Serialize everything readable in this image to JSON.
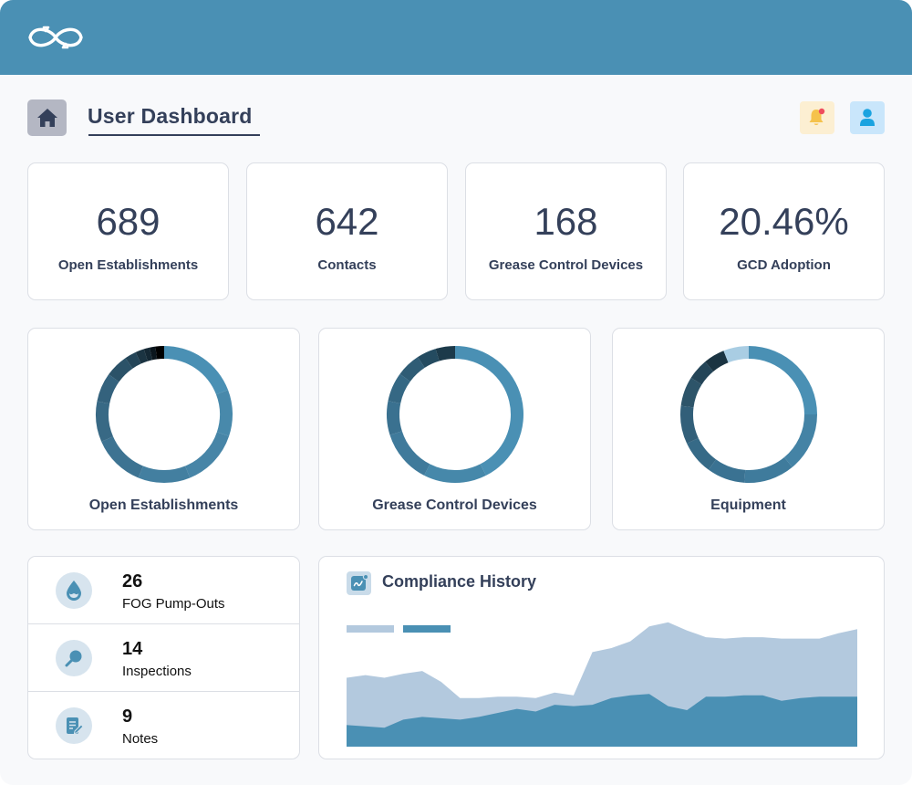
{
  "header": {
    "logo_icon": "infinity-recycle-icon",
    "brand_color": "#4a90b4"
  },
  "page": {
    "title": "User Dashboard",
    "home_icon": "home-icon",
    "notification_icon": "bell-icon",
    "notification_badge": true,
    "profile_icon": "user-icon"
  },
  "stats": [
    {
      "value": "689",
      "label": "Open Establishments"
    },
    {
      "value": "642",
      "label": "Contacts"
    },
    {
      "value": "168",
      "label": "Grease Control Devices"
    },
    {
      "value": "20.46%",
      "label": "GCD Adoption"
    }
  ],
  "donuts": [
    {
      "label": "Open Establishments",
      "segments": [
        {
          "value": 14,
          "color": "#4a90b4"
        },
        {
          "value": 8,
          "color": "#4889ab"
        },
        {
          "value": 10,
          "color": "#4785a7"
        },
        {
          "value": 9,
          "color": "#437fa0"
        },
        {
          "value": 9,
          "color": "#3d7392"
        },
        {
          "value": 7,
          "color": "#386985"
        },
        {
          "value": 5,
          "color": "#34627d"
        },
        {
          "value": 4,
          "color": "#2b5268"
        },
        {
          "value": 2,
          "color": "#244558"
        },
        {
          "value": 1.5,
          "color": "#1b3442"
        },
        {
          "value": 1,
          "color": "#142834"
        },
        {
          "value": 1,
          "color": "#0b161d"
        },
        {
          "value": 1.5,
          "color": "#000000"
        }
      ]
    },
    {
      "label": "Grease Control Devices",
      "segments": [
        {
          "value": 37,
          "color": "#4a90b4"
        },
        {
          "value": 13,
          "color": "#4688aa"
        },
        {
          "value": 11,
          "color": "#3f7a9b"
        },
        {
          "value": 7,
          "color": "#3a7190"
        },
        {
          "value": 6,
          "color": "#356884"
        },
        {
          "value": 5,
          "color": "#2f5c75"
        },
        {
          "value": 4,
          "color": "#244b60"
        },
        {
          "value": 4,
          "color": "#1c3a4a"
        }
      ]
    },
    {
      "label": "Equipment",
      "segments": [
        {
          "value": 25,
          "color": "#4a90b4"
        },
        {
          "value": 14,
          "color": "#4483a5"
        },
        {
          "value": 12,
          "color": "#3f7b9c"
        },
        {
          "value": 9,
          "color": "#3a7292"
        },
        {
          "value": 8,
          "color": "#366a87"
        },
        {
          "value": 9,
          "color": "#325f79"
        },
        {
          "value": 7,
          "color": "#2d5469"
        },
        {
          "value": 5,
          "color": "#244558"
        },
        {
          "value": 5,
          "color": "#1b3442"
        },
        {
          "value": 6,
          "color": "#a9cde3"
        }
      ]
    }
  ],
  "activity": [
    {
      "value": "26",
      "label": "FOG Pump-Outs",
      "icon": "water-drop-icon"
    },
    {
      "value": "14",
      "label": "Inspections",
      "icon": "magnifier-icon"
    },
    {
      "value": "9",
      "label": "Notes",
      "icon": "note-edit-icon"
    }
  ],
  "compliance": {
    "title": "Compliance History",
    "icon": "trend-chart-icon"
  },
  "chart_data": {
    "type": "area",
    "title": "Compliance History",
    "xlabel": "",
    "ylabel": "",
    "ylim": [
      0,
      100
    ],
    "legend_position": "top-left",
    "grid": false,
    "x": [
      0,
      1,
      2,
      3,
      4,
      5,
      6,
      7,
      8,
      9,
      10,
      11,
      12,
      13,
      14,
      15,
      16,
      17,
      18,
      19,
      20,
      21,
      22,
      23,
      24,
      25,
      26,
      27
    ],
    "series": [
      {
        "name": "",
        "color": "#b3c9de",
        "values": [
          51,
          53,
          51,
          54,
          56,
          48,
          36,
          36,
          37,
          37,
          36,
          40,
          38,
          70,
          73,
          78,
          89,
          92,
          86,
          81,
          80,
          81,
          81,
          80,
          80,
          80,
          84,
          87
        ]
      },
      {
        "name": "",
        "color": "#4a90b4",
        "values": [
          16,
          15,
          14,
          20,
          22,
          21,
          20,
          22,
          25,
          28,
          26,
          31,
          30,
          31,
          36,
          38,
          39,
          30,
          27,
          37,
          37,
          38,
          38,
          34,
          36,
          37,
          37,
          37
        ]
      }
    ]
  }
}
